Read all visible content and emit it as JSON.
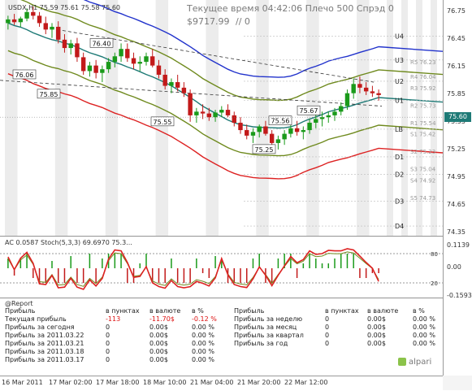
{
  "header": {
    "symbol_line": "USDX,H1  75.59 75.61 75.58 75.60",
    "server_time": "Текущее время 04:42:06 Плечо 500 Спрэд 0",
    "equity": "$9717.99",
    "equity_suffix": "// 0"
  },
  "current_price": "75.60",
  "colors": {
    "bull": "#1a9a1a",
    "bear": "#c21a1a",
    "teal": "#1e7a76",
    "olive": "#6f8a1e",
    "band_blue": "#2233cc",
    "band_red": "#dd2222",
    "stripe": "#ececec"
  },
  "oscillator": {
    "title": "AC 0.0587  Stoch(5,3,3) 69.6970 75.3...",
    "levels": [
      "80",
      "20"
    ],
    "scale": [
      "0.1139",
      "0.00",
      "-0.1593"
    ]
  },
  "report": {
    "title": "@Report",
    "left_headers": [
      "Прибыль",
      "в пунктах",
      "в валюте",
      "в %"
    ],
    "left_rows": [
      [
        "Текущая прибыль",
        "-113",
        "-11.70$",
        "-0.12 %"
      ],
      [
        "Прибыль за сегодня",
        "0",
        "0.00$",
        "0.00 %"
      ],
      [
        "Прибыль за 2011.03.22",
        "0",
        "0.00$",
        "0.00 %"
      ],
      [
        "Прибыль за 2011.03.21",
        "0",
        "0.00$",
        "0.00 %"
      ],
      [
        "Прибыль за 2011.03.18",
        "0",
        "0.00$",
        "0.00 %"
      ],
      [
        "Прибыль за 2011.03.17",
        "0",
        "0.00$",
        "0.00 %"
      ]
    ],
    "right_headers": [
      "Прибыль",
      "в пунктах",
      "в валюте",
      "в %"
    ],
    "right_rows": [
      [
        "Прибыль за неделю",
        "0",
        "0.00$",
        "0.00 %"
      ],
      [
        "Прибыль за месяц",
        "0",
        "0.00$",
        "0.00 %"
      ],
      [
        "Прибыль за квартал",
        "0",
        "0.00$",
        "0.00 %"
      ],
      [
        "Прибыль за год",
        "0",
        "0.00$",
        "0.00 %"
      ]
    ]
  },
  "logo_text": "alpari",
  "chart_data": {
    "type": "candlestick",
    "symbol": "USDX",
    "timeframe": "H1",
    "x_tick_labels": [
      "16 Mar 2011",
      "17 Mar 02:00",
      "17 Mar 18:00",
      "18 Mar 10:00",
      "21 Mar 04:00",
      "21 Mar 20:00",
      "22 Mar 12:00"
    ],
    "y_tick_labels": [
      "76.75",
      "76.45",
      "76.15",
      "75.85",
      "75.55",
      "75.25",
      "74.95",
      "74.65",
      "74.35"
    ],
    "ylim": [
      74.35,
      76.8
    ],
    "pivot_levels": [
      {
        "name": "U4",
        "value": 76.48
      },
      {
        "name": "U3",
        "value": 76.22
      },
      {
        "name": "U2",
        "value": 75.99
      },
      {
        "name": "U1",
        "value": 75.78
      },
      {
        "name": "LB",
        "value": 75.47
      },
      {
        "name": "D1",
        "value": 75.17
      },
      {
        "name": "D2",
        "value": 74.98
      },
      {
        "name": "D3",
        "value": 74.69
      },
      {
        "name": "D4",
        "value": 74.42
      }
    ],
    "resistance_support_labels": [
      {
        "name": "R5 76.23",
        "value": 76.2
      },
      {
        "name": "R4 76.04",
        "value": 76.04
      },
      {
        "name": "R3 75.92",
        "value": 75.92
      },
      {
        "name": "R2 75.73",
        "value": 75.73
      },
      {
        "name": "R1 75.54",
        "value": 75.54
      },
      {
        "name": "S1 75.42",
        "value": 75.42
      },
      {
        "name": "S2 75.23",
        "value": 75.23
      },
      {
        "name": "S3 75.04",
        "value": 75.04
      },
      {
        "name": "S4 74.92",
        "value": 74.92
      },
      {
        "name": "S5 74.73",
        "value": 74.73
      }
    ],
    "annotations": [
      {
        "text": "76.06",
        "value": 76.06
      },
      {
        "text": "75.85",
        "value": 75.85
      },
      {
        "text": "76.40",
        "value": 76.4
      },
      {
        "text": "75.55",
        "value": 75.55
      },
      {
        "text": "75.56",
        "value": 75.56
      },
      {
        "text": "75.67",
        "value": 75.67
      },
      {
        "text": "75.25",
        "value": 75.25
      }
    ],
    "candles": [
      [
        76.62,
        76.7,
        76.55,
        76.66
      ],
      [
        76.66,
        76.72,
        76.6,
        76.63
      ],
      [
        76.63,
        76.69,
        76.58,
        76.67
      ],
      [
        76.67,
        76.78,
        76.64,
        76.74
      ],
      [
        76.74,
        76.8,
        76.66,
        76.7
      ],
      [
        76.7,
        76.74,
        76.58,
        76.62
      ],
      [
        76.62,
        76.69,
        76.5,
        76.55
      ],
      [
        76.55,
        76.62,
        76.46,
        76.58
      ],
      [
        76.58,
        76.64,
        76.4,
        76.44
      ],
      [
        76.44,
        76.5,
        76.3,
        76.35
      ],
      [
        76.35,
        76.44,
        76.28,
        76.4
      ],
      [
        76.4,
        76.46,
        76.2,
        76.25
      ],
      [
        76.25,
        76.3,
        76.06,
        76.1
      ],
      [
        76.1,
        76.2,
        76.04,
        76.16
      ],
      [
        76.16,
        76.22,
        76.02,
        76.08
      ],
      [
        76.08,
        76.16,
        75.98,
        76.12
      ],
      [
        76.12,
        76.24,
        76.08,
        76.2
      ],
      [
        76.2,
        76.3,
        76.14,
        76.26
      ],
      [
        76.26,
        76.4,
        76.2,
        76.34
      ],
      [
        76.34,
        76.4,
        76.2,
        76.24
      ],
      [
        76.24,
        76.3,
        76.12,
        76.18
      ],
      [
        76.18,
        76.26,
        76.1,
        76.2
      ],
      [
        76.2,
        76.3,
        76.16,
        76.26
      ],
      [
        76.26,
        76.34,
        76.14,
        76.16
      ],
      [
        76.16,
        76.22,
        76.02,
        76.06
      ],
      [
        76.06,
        76.12,
        75.9,
        75.94
      ],
      [
        75.94,
        76.02,
        75.86,
        75.98
      ],
      [
        75.98,
        76.06,
        75.88,
        75.92
      ],
      [
        75.92,
        75.98,
        75.82,
        75.86
      ],
      [
        75.86,
        75.9,
        75.55,
        75.62
      ],
      [
        75.62,
        75.7,
        75.54,
        75.66
      ],
      [
        75.66,
        75.74,
        75.58,
        75.64
      ],
      [
        75.64,
        75.7,
        75.56,
        75.6
      ],
      [
        75.6,
        75.68,
        75.55,
        75.65
      ],
      [
        75.65,
        75.72,
        75.6,
        75.68
      ],
      [
        75.68,
        75.74,
        75.6,
        75.62
      ],
      [
        75.62,
        75.66,
        75.5,
        75.54
      ],
      [
        75.54,
        75.6,
        75.42,
        75.46
      ],
      [
        75.46,
        75.52,
        75.36,
        75.4
      ],
      [
        75.4,
        75.48,
        75.32,
        75.44
      ],
      [
        75.44,
        75.52,
        75.38,
        75.5
      ],
      [
        75.5,
        75.56,
        75.4,
        75.42
      ],
      [
        75.42,
        75.46,
        75.28,
        75.32
      ],
      [
        75.32,
        75.4,
        75.25,
        75.36
      ],
      [
        75.36,
        75.46,
        75.3,
        75.42
      ],
      [
        75.42,
        75.52,
        75.38,
        75.48
      ],
      [
        75.48,
        75.56,
        75.4,
        75.44
      ],
      [
        75.44,
        75.5,
        75.36,
        75.46
      ],
      [
        75.46,
        75.58,
        75.42,
        75.54
      ],
      [
        75.54,
        75.64,
        75.48,
        75.58
      ],
      [
        75.58,
        75.66,
        75.5,
        75.6
      ],
      [
        75.6,
        75.66,
        75.54,
        75.62
      ],
      [
        75.62,
        75.7,
        75.56,
        75.66
      ],
      [
        75.66,
        75.76,
        75.62,
        75.72
      ],
      [
        75.72,
        75.9,
        75.68,
        75.86
      ],
      [
        75.86,
        76.02,
        75.8,
        75.96
      ],
      [
        75.96,
        76.04,
        75.86,
        75.92
      ],
      [
        75.92,
        75.98,
        75.84,
        75.88
      ],
      [
        75.88,
        75.94,
        75.82,
        75.86
      ],
      [
        75.86,
        75.9,
        75.78,
        75.84
      ]
    ]
  }
}
